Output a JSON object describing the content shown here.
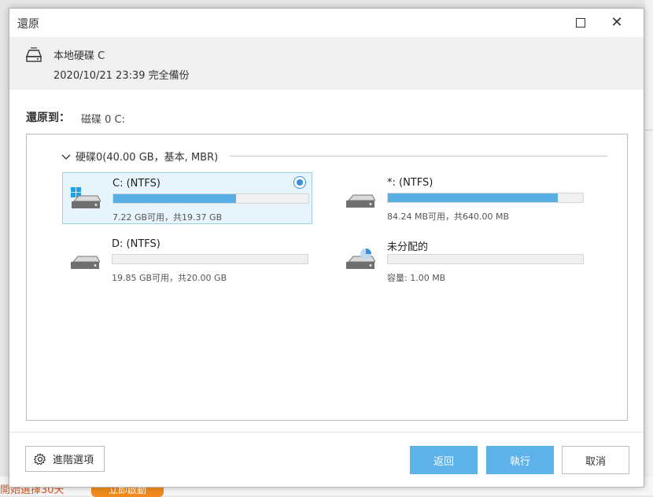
{
  "background": {
    "promo_text": "開始選擇30天",
    "promo_button": "立即啟動"
  },
  "window": {
    "title": "還原"
  },
  "source": {
    "name": "本地硬碟 C",
    "date": "2020/10/21 23:39 完全備份"
  },
  "restore_to": {
    "label": "還原到：",
    "target": "磁碟 0 C:"
  },
  "disk": {
    "title": "硬碟0(40.00 GB，基本, MBR)",
    "partitions": [
      {
        "name": "C: (NTFS)",
        "info": "7.22 GB可用，共19.37 GB",
        "used_fraction": 0.63,
        "selected": true,
        "icon": "windows-drive-icon"
      },
      {
        "name": "*: (NTFS)",
        "info": "84.24 MB可用，共640.00 MB",
        "used_fraction": 0.87,
        "selected": false,
        "icon": "drive-icon"
      },
      {
        "name": "D: (NTFS)",
        "info": "19.85 GB可用，共20.00 GB",
        "used_fraction": 0.0,
        "selected": false,
        "icon": "drive-icon"
      },
      {
        "name": "未分配的",
        "info": "容量: 1.00 MB",
        "used_fraction": 0.0,
        "selected": false,
        "icon": "unallocated-drive-icon"
      }
    ]
  },
  "footer": {
    "advanced_label": "進階選項",
    "back_label": "返回",
    "execute_label": "執行",
    "cancel_label": "取消"
  },
  "colors": {
    "accent": "#5db2ea",
    "selected_bg": "#e8f4fb",
    "bar_fill": "#5aaee6"
  }
}
